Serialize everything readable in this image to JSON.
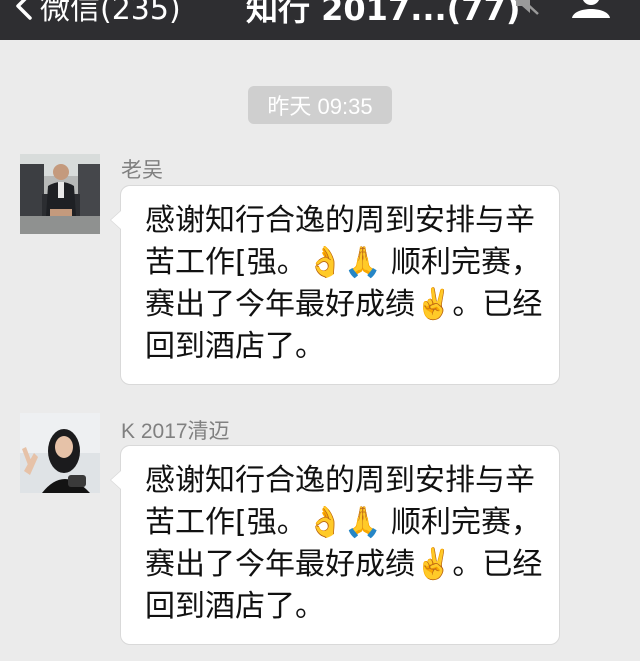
{
  "nav": {
    "back_label": "微信(235)",
    "title": "知行 2017...(77)",
    "back_icon": "chevron-left-icon",
    "mute_icon": "mute-icon",
    "profile_icon": "group-profile-icon"
  },
  "chat": {
    "timestamp": "昨天 09:35",
    "messages": [
      {
        "sender": "老吴",
        "text": "感谢知行合逸的周到安排与辛苦工作[强。👌🙏 顺利完赛，赛出了今年最好成绩✌️。已经回到酒店了。"
      },
      {
        "sender": "K 2017清迈",
        "text": "感谢知行合逸的周到安排与辛苦工作[强。👌🙏 顺利完赛，赛出了今年最好成绩✌️。已经回到酒店了。"
      }
    ]
  },
  "colors": {
    "nav_bg": "#2e2e31",
    "chat_bg": "#ebebeb",
    "bubble_bg": "#ffffff",
    "timestamp_bg": "#cfcfcf"
  }
}
